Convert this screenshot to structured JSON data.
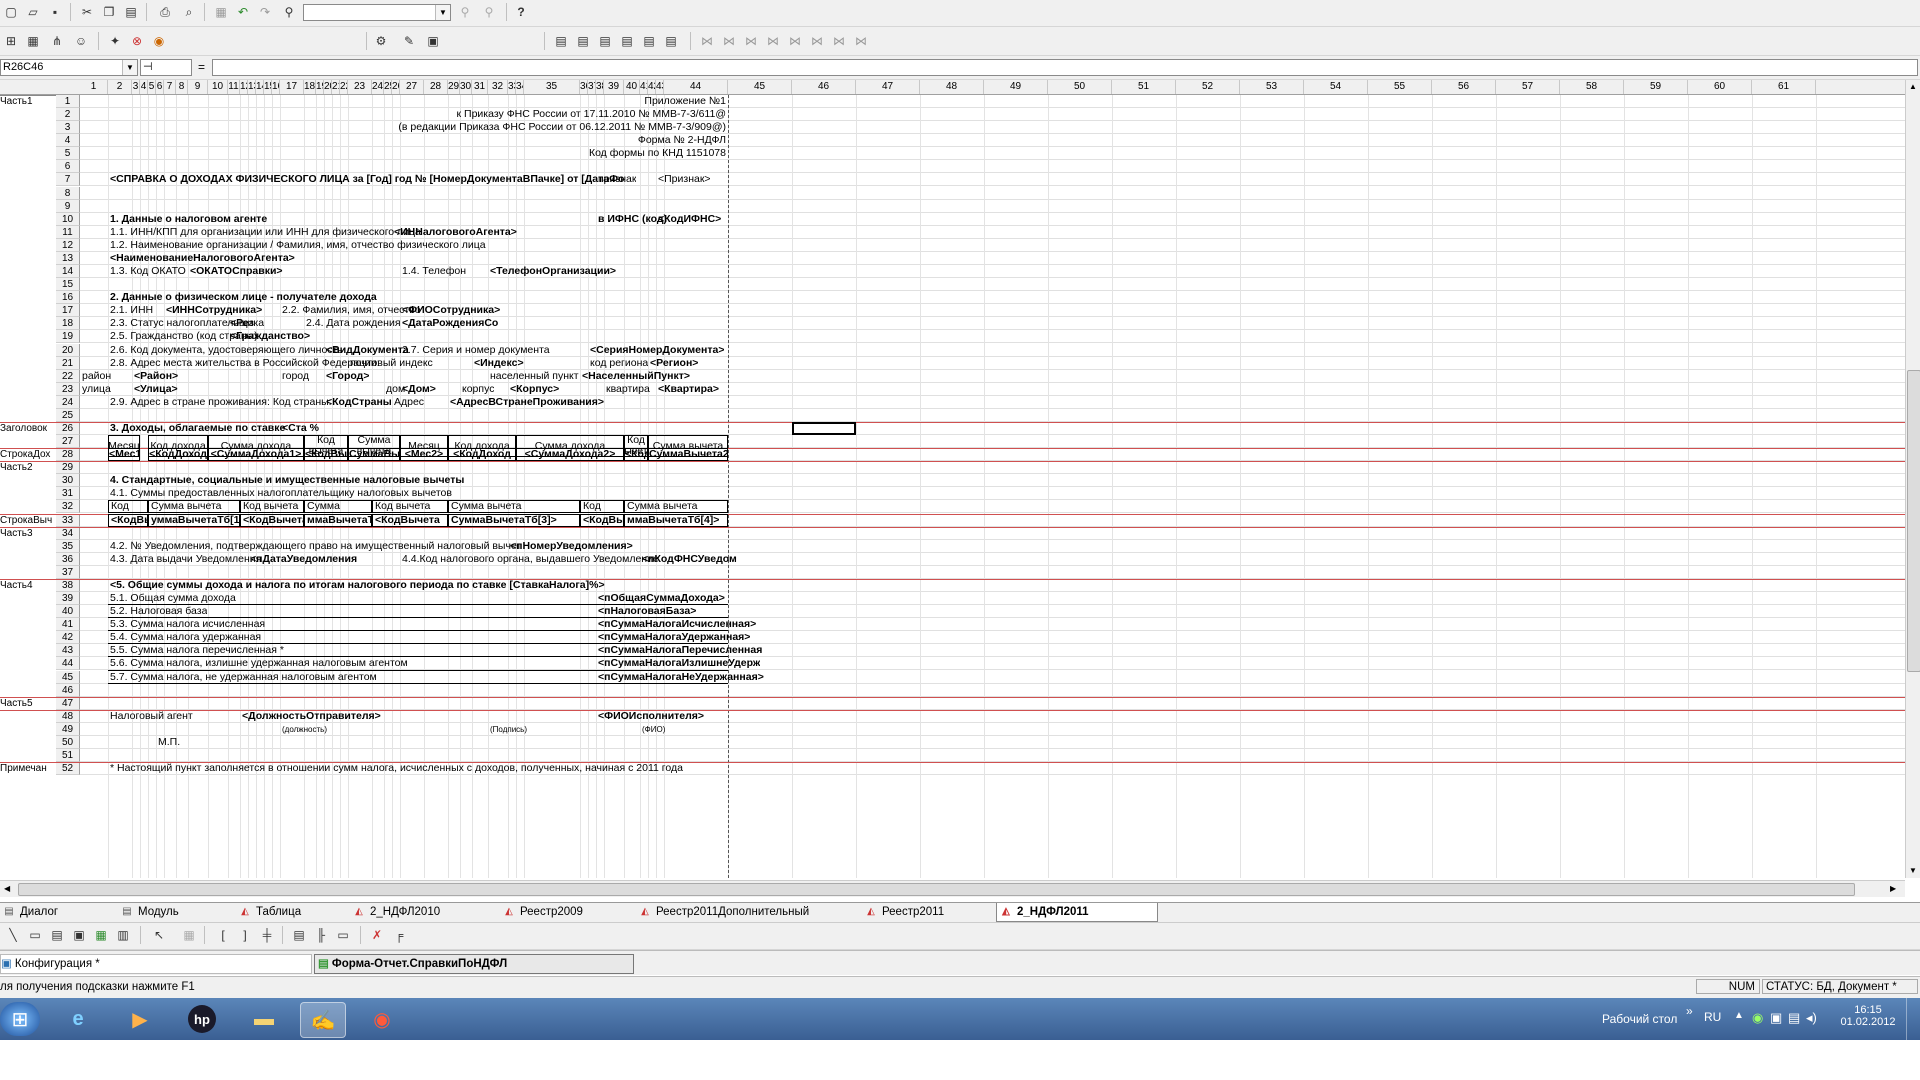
{
  "toolbar1": {
    "icons": [
      "new-icon",
      "open-icon",
      "save-icon",
      "cut-icon",
      "copy-icon",
      "paste-icon",
      "print-icon",
      "print-preview-icon",
      "undo-icon",
      "redo-icon",
      "find-icon",
      "help-icon"
    ],
    "help_glyph": "?"
  },
  "toolbar3": {
    "cell_ref": "R26C46",
    "eq": "="
  },
  "columns": [
    "1",
    "2",
    "3",
    "4",
    "5",
    "6",
    "7",
    "8",
    "9",
    "10",
    "11",
    "12",
    "13",
    "14",
    "15",
    "16",
    "17",
    "18",
    "19",
    "20",
    "21",
    "22",
    "23",
    "24",
    "25",
    "26",
    "27",
    "28",
    "29",
    "30",
    "31",
    "32",
    "33",
    "34",
    "35",
    "36",
    "37",
    "38",
    "39",
    "40",
    "41",
    "42",
    "43",
    "44",
    "45",
    "46",
    "47",
    "48",
    "49",
    "50",
    "51",
    "52",
    "53",
    "54",
    "55",
    "56",
    "57",
    "58",
    "59",
    "60",
    "61"
  ],
  "groups": {
    "part1": "Часть1",
    "header": "Заголовок",
    "income_row": "СтрокаДох",
    "part2": "Часть2",
    "deduction_row": "СтрокаВыч",
    "part3": "Часть3",
    "part4": "Часть4",
    "part5": "Часть5",
    "notes": "Примечан"
  },
  "rows": [
    "1",
    "2",
    "3",
    "4",
    "5",
    "6",
    "7",
    "8",
    "9",
    "10",
    "11",
    "12",
    "13",
    "14",
    "15",
    "16",
    "17",
    "18",
    "19",
    "20",
    "21",
    "22",
    "23",
    "24",
    "25",
    "26",
    "27",
    "28",
    "29",
    "30",
    "31",
    "32",
    "33",
    "34",
    "35",
    "36",
    "37",
    "38",
    "39",
    "40",
    "41",
    "42",
    "43",
    "44",
    "45",
    "46",
    "47",
    "48",
    "49",
    "50",
    "51",
    "52"
  ],
  "form": {
    "r1": "Приложение №1",
    "r2": "к Приказу ФНС России от 17.11.2010 № ММВ-7-3/611@",
    "r3": "(в редакции Приказа ФНС России от 06.12.2011 № ММВ-7-3/909@)",
    "r4": "Форма № 2-НДФЛ",
    "r5": "Код формы по КНД 1151078",
    "r7_title": "<СПРАВКА О ДОХОДАХ ФИЗИЧЕСКОГО ЛИЦА за [Год] год № [НомерДокументаВПачке] от [ДатаФо",
    "r7_sign_label": "признак",
    "r7_sign": "<Признак>",
    "r10_title": "1. Данные о налоговом агенте",
    "r10_ifns_label": "в ИФНС (код)",
    "r10_ifns": "<КодИФНС>",
    "r11_label": "1.1. ИНН/КПП для организации или ИНН для физического лица",
    "r11_val": "<ИННалоговогоАгента>",
    "r12_label": "1.2. Наименование организации / Фамилия, имя, отчество физического лица",
    "r13_val": "<НаименованиеНалоговогоАгента>",
    "r14_okato_label": "1.3. Код ОКАТО",
    "r14_okato": "<ОКАТОСправки>",
    "r14_phone_label": "1.4. Телефон",
    "r14_phone": "<ТелефонОрганизации>",
    "r16_title": "2. Данные о физическом лице - получателе дохода",
    "r17_inn_label": "2.1. ИНН",
    "r17_inn": "<ИННСотрудника>",
    "r17_fio_label": "2.2. Фамилия, имя, отчество",
    "r17_fio": "<ФИОСотрудника>",
    "r18_status_label": "2.3. Статус налогоплательщика",
    "r18_status": "<Рез",
    "r18_dob_label": "2.4. Дата рождения",
    "r18_dob": "<ДатаРожденияСо",
    "r19_label": "2.5. Гражданство (код страны)",
    "r19_val": "<Гражданство>",
    "r20_doc_label": "2.6. Код документа, удостоверяющего личность",
    "r20_doc": "<ВидДокумента",
    "r20_ser_label": "2.7. Серия и номер документа",
    "r20_ser": "<СерияНомерДокумента>",
    "r21_addr_label": "2.8. Адрес места жительства в Российской Федерации:",
    "r21_zip_label": "почтовый индекс",
    "r21_zip": "<Индекс>",
    "r21_reg_label": "код региона",
    "r21_reg": "<Регион>",
    "r22_dist_label": "район",
    "r22_dist": "<Район>",
    "r22_city_label": "город",
    "r22_city": "<Город>",
    "r22_np_label": "населенный пункт",
    "r22_np": "<НаселенныйПункт>",
    "r23_str_label": "улица",
    "r23_str": "<Улица>",
    "r23_house_label": "дом",
    "r23_house": "<Дом>",
    "r23_korp_label": "корпус",
    "r23_korp": "<Корпус>",
    "r23_flat_label": "квартира",
    "r23_flat": "<Квартира>",
    "r24_label": "2.9. Адрес в стране проживания: Код страны:",
    "r24_country": "<КодСтраны",
    "r24_addr_label": "Адрес",
    "r24_addr": "<АдресВСтранеПроживания>",
    "r26_title": "3. Доходы, облагаемые по ставке",
    "r26_rate": "<Ста %",
    "inc_hdr": [
      "Месяц",
      "Код дохода",
      "Сумма дохода",
      "Код вычета",
      "Сумма вычета",
      "Месяц",
      "Код дохода",
      "Сумма дохода",
      "Код вычета",
      "Сумма вычета"
    ],
    "inc_row": [
      "<Мес1>",
      "<КодДоход",
      "<СуммаДохода1>",
      "<КодВычет",
      "СуммаВычета1>",
      "<Мес2>",
      "<КодДоход",
      "<СуммаДохода2>",
      "<КодВычет",
      "СуммаВычета2>"
    ],
    "r30_title": "4. Стандартные, социальные и имущественные налоговые вычеты",
    "r31_label": "4.1. Суммы предоставленных налогоплательщику налоговых вычетов",
    "ded_hdr": [
      "Код вычета",
      "Сумма вычета",
      "Код вычета",
      "Сумма вычета",
      "Код вычета",
      "Сумма вычета",
      "Код вычета",
      "Сумма вычета"
    ],
    "ded_row": [
      "<КодВычета",
      "уммаВычетаТб[1]>",
      "<КодВычета",
      "ммаВычетаТб[2]>",
      "<КодВычета",
      "СуммаВычетаТб[3]>",
      "<КодВычета",
      "ммаВычетаТб[4]>"
    ],
    "r35_label": "4.2. № Уведомления, подтверждающего право на имущественный налоговый вычет",
    "r35_val": "<пНомерУведомления>",
    "r36_label": "4.3. Дата выдачи Уведомления",
    "r36_date": "<пДатаУведомления",
    "r36_org_label": "4.4.Код налогового органа, выдавшего Уведомление",
    "r36_org": "<пКодФНСУведом",
    "r38_title": "<5.  Общие суммы дохода и налога по итогам налогового периода по ставке [СтавкаНалога]%>",
    "totals": [
      {
        "label": "5.1. Общая сумма дохода",
        "val": "<пОбщаяСуммаДохода>"
      },
      {
        "label": "5.2. Налоговая база",
        "val": "<пНалоговаяБаза>"
      },
      {
        "label": "5.3. Сумма налога исчисленная",
        "val": "<пСуммаНалогаИсчисленная>"
      },
      {
        "label": "5.4. Сумма налога удержанная",
        "val": "<пСуммаНалогаУдержанная>"
      },
      {
        "label": "5.5. Сумма налога перечисленная *",
        "val": "<пСуммаНалогаПеречисленная"
      },
      {
        "label": "5.6. Сумма налога, излишне удержанная налоговым агентом",
        "val": "<пСуммаНалогаИзлишнеУдерж"
      },
      {
        "label": "5.7. Сумма налога, не удержанная налоговым агентом",
        "val": "<пСуммаНалогаНеУдержанная>"
      }
    ],
    "r48_label": "Налоговый агент",
    "r48_pos": "<ДолжностьОтправителя>",
    "r48_fio": "<ФИОИсполнителя>",
    "r49_pos": "(должность)",
    "r49_sig": "(Подпись)",
    "r49_fio": "(ФИО)",
    "r50_mp": "М.П.",
    "r52_note": "* Настоящий пункт заполняется в отношении сумм налога, исчисленных с доходов, полученных, начиная с 2011 года"
  },
  "sheet_tabs": [
    "Диалог",
    "Модуль",
    "Таблица",
    "2_НДФЛ2010",
    "Реестр2009",
    "Реестр2011Дополнительный",
    "Реестр2011",
    "2_НДФЛ2011"
  ],
  "active_tab": "2_НДФЛ2011",
  "windows": [
    "Конфигурация *",
    "Форма-Отчет.СправкиПоНДФЛ"
  ],
  "status": {
    "hint": "ля получения подсказки нажмите F1",
    "num": "NUM",
    "state": "СТАТУС: БД, Документ *"
  },
  "taskbar": {
    "desktop": "Рабочий стол",
    "lang": "RU",
    "time": "16:15",
    "date": "01.02.2012",
    "chevron": "»"
  }
}
